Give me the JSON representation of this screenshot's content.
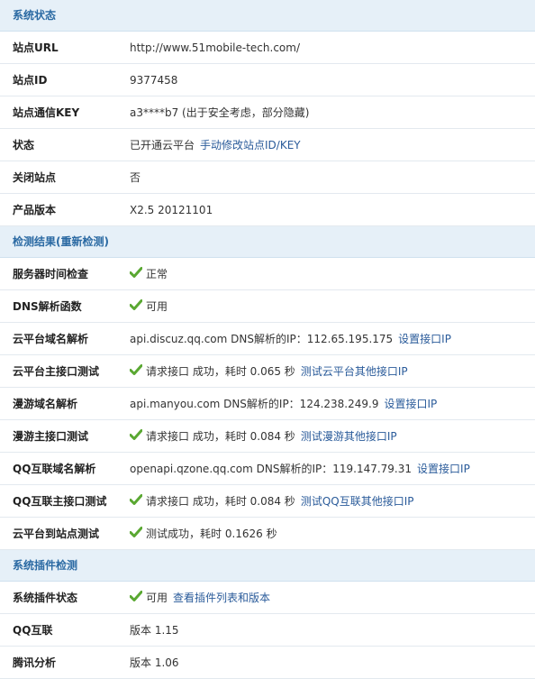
{
  "section_system": {
    "title": "系统状态"
  },
  "system_rows": [
    {
      "label": "站点URL",
      "value": "http://www.51mobile-tech.com/"
    },
    {
      "label": "站点ID",
      "value": "9377458"
    },
    {
      "label": "站点通信KEY",
      "value": "a3****b7 (出于安全考虑，部分隐藏)"
    },
    {
      "label": "状态",
      "value": "已开通云平台",
      "link": "手动修改站点ID/KEY"
    },
    {
      "label": "关闭站点",
      "value": "否"
    },
    {
      "label": "产品版本",
      "value": "X2.5 20121101"
    }
  ],
  "section_check": {
    "title": "检测结果(重新检测)"
  },
  "check_rows": [
    {
      "label": "服务器时间检查",
      "ok": true,
      "value": "正常"
    },
    {
      "label": "DNS解析函数",
      "ok": true,
      "value": "可用"
    },
    {
      "label": "云平台域名解析",
      "ok": false,
      "value": "api.discuz.qq.com DNS解析的IP：112.65.195.175",
      "link": "设置接口IP"
    },
    {
      "label": "云平台主接口测试",
      "ok": true,
      "value": "请求接口 成功，耗时 0.065 秒",
      "link": "测试云平台其他接口IP"
    },
    {
      "label": "漫游域名解析",
      "ok": false,
      "value": "api.manyou.com DNS解析的IP：124.238.249.9",
      "link": "设置接口IP"
    },
    {
      "label": "漫游主接口测试",
      "ok": true,
      "value": "请求接口 成功，耗时 0.084 秒",
      "link": "测试漫游其他接口IP"
    },
    {
      "label": "QQ互联域名解析",
      "ok": false,
      "value": "openapi.qzone.qq.com DNS解析的IP：119.147.79.31",
      "link": "设置接口IP"
    },
    {
      "label": "QQ互联主接口测试",
      "ok": true,
      "value": "请求接口 成功，耗时 0.084 秒",
      "link": "测试QQ互联其他接口IP"
    },
    {
      "label": "云平台到站点测试",
      "ok": true,
      "value": "测试成功，耗时 0.1626 秒"
    }
  ],
  "section_plugin": {
    "title": "系统插件检测"
  },
  "plugin_rows": [
    {
      "label": "系统插件状态",
      "ok": true,
      "value": "可用",
      "link": "查看插件列表和版本"
    },
    {
      "label": "QQ互联",
      "ok": false,
      "value": "版本 1.15"
    },
    {
      "label": "腾讯分析",
      "ok": false,
      "value": "版本 1.06"
    }
  ],
  "colors": {
    "header_bg": "#e6f0f8",
    "header_text": "#2b6aa3",
    "link": "#2a5b9a",
    "check": "#5aa832"
  }
}
